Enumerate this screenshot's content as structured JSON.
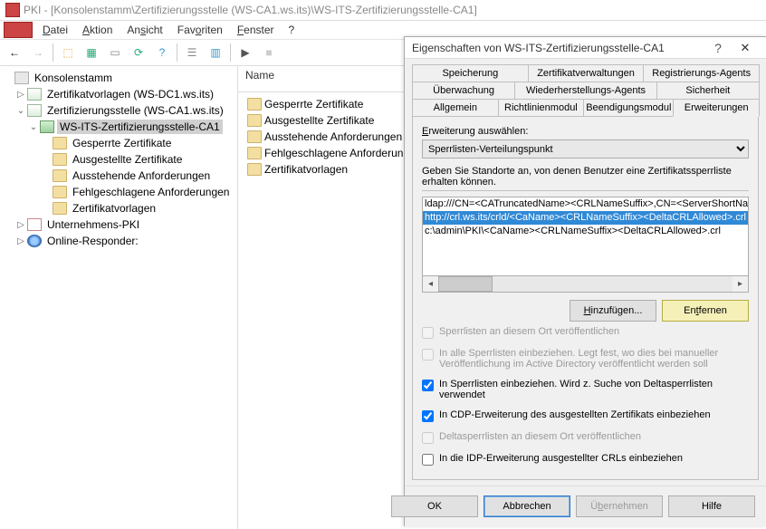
{
  "window": {
    "title": "PKI - [Konsolenstamm\\Zertifizierungsstelle (WS-CA1.ws.its)\\WS-ITS-Zertifizierungsstelle-CA1]"
  },
  "menu": {
    "datei": "Datei",
    "aktion": "Aktion",
    "ansicht": "Ansicht",
    "favoriten": "Favoriten",
    "fenster": "Fenster",
    "help": "?"
  },
  "tree": {
    "root": "Konsolenstamm",
    "certTemplates": "Zertifikatvorlagen (WS-DC1.ws.its)",
    "ca": "Zertifizierungsstelle (WS-CA1.ws.its)",
    "caName": "WS-ITS-Zertifizierungsstelle-CA1",
    "n1": "Gesperrte Zertifikate",
    "n2": "Ausgestellte Zertifikate",
    "n3": "Ausstehende Anforderungen",
    "n4": "Fehlgeschlagene Anforderungen",
    "n5": "Zertifikatvorlagen",
    "upki": "Unternehmens-PKI",
    "resp": "Online-Responder:"
  },
  "list": {
    "header": "Name",
    "i1": "Gesperrte Zertifikate",
    "i2": "Ausgestellte Zertifikate",
    "i3": "Ausstehende Anforderungen",
    "i4": "Fehlgeschlagene Anforderungen",
    "i5": "Zertifikatvorlagen"
  },
  "dialog": {
    "title": "Eigenschaften von WS-ITS-Zertifizierungsstelle-CA1",
    "tabs": {
      "speicherung": "Speicherung",
      "zertverw": "Zertifikatverwaltungen",
      "regagents": "Registrierungs-Agents",
      "ueberw": "Überwachung",
      "wiederh": "Wiederherstellungs-Agents",
      "sicherheit": "Sicherheit",
      "allgemein": "Allgemein",
      "richtlinien": "Richtlinienmodul",
      "beendigung": "Beendigungsmodul",
      "erweit": "Erweiterungen"
    },
    "extSelectLbl": "Erweiterung auswählen:",
    "extSelected": "Sperrlisten-Verteilungspunkt",
    "locInfo": "Geben Sie Standorte an, von denen Benutzer eine Zertifikatssperrliste erhalten können.",
    "loc1": "ldap:///CN=<CATruncatedName><CRLNameSuffix>,CN=<ServerShortName>",
    "loc2": "http://crl.ws.its/crld/<CaName><CRLNameSuffix><DeltaCRLAllowed>.crl",
    "loc3": "c:\\admin\\PKI\\<CaName><CRLNameSuffix><DeltaCRLAllowed>.crl",
    "addBtn": "Hinzufügen...",
    "removeBtn": "Entfernen",
    "chk1": "Sperrlisten an diesem Ort veröffentlichen",
    "chk2": "In alle Sperrlisten einbeziehen. Legt fest, wo dies bei manueller Veröffentlichung im Active Directory veröffentlicht werden soll",
    "chk3": "In Sperrlisten einbeziehen. Wird z. Suche von Deltasperrlisten verwendet",
    "chk4": "In CDP-Erweiterung des ausgestellten Zertifikats einbeziehen",
    "chk5": "Deltasperrlisten an diesem Ort veröffentlichen",
    "chk6": "In die IDP-Erweiterung ausgestellter CRLs einbeziehen",
    "ok": "OK",
    "cancel": "Abbrechen",
    "apply": "Übernehmen",
    "helpBtn": "Hilfe"
  }
}
